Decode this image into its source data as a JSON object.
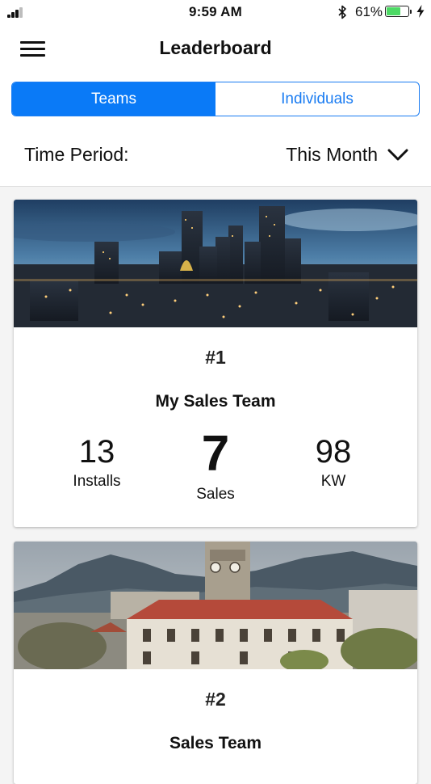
{
  "status_bar": {
    "time": "9:59 AM",
    "battery_percent": "61%",
    "battery_level": 0.61,
    "icons": [
      "signal-icon",
      "bluetooth-icon",
      "battery-icon",
      "charging-icon"
    ]
  },
  "header": {
    "title": "Leaderboard",
    "menu_icon": "hamburger-menu-icon"
  },
  "tabs": [
    {
      "label": "Teams",
      "active": true
    },
    {
      "label": "Individuals",
      "active": false
    }
  ],
  "filter": {
    "label": "Time Period:",
    "value": "This Month",
    "icon": "chevron-down-icon"
  },
  "teams": [
    {
      "rank": "#1",
      "name": "My Sales Team",
      "image": "city-skyline-dusk",
      "stats": [
        {
          "value": "13",
          "label": "Installs"
        },
        {
          "value": "7",
          "label": "Sales"
        },
        {
          "value": "98",
          "label": "KW"
        }
      ]
    },
    {
      "rank": "#2",
      "name": "Sales Team",
      "image": "clocktower-mountains"
    }
  ],
  "colors": {
    "accent": "#0a7af7",
    "background": "#f4f4f4",
    "battery_green": "#4cd964"
  }
}
